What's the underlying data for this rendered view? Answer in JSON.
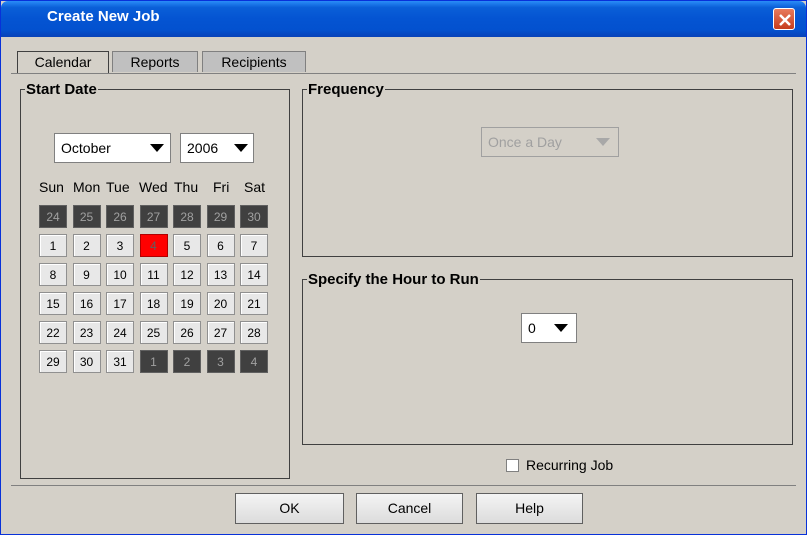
{
  "window": {
    "title": "Create New Job"
  },
  "tabs": [
    {
      "label": "Calendar"
    },
    {
      "label": "Reports"
    },
    {
      "label": "Recipients"
    }
  ],
  "start_date": {
    "legend": "Start Date",
    "month": "October",
    "year": "2006",
    "weekdays": [
      "Sun",
      "Mon",
      "Tue",
      "Wed",
      "Thu",
      "Fri",
      "Sat"
    ],
    "weeks": [
      [
        "24",
        "25",
        "26",
        "27",
        "28",
        "29",
        "30"
      ],
      [
        "1",
        "2",
        "3",
        "4",
        "5",
        "6",
        "7"
      ],
      [
        "8",
        "9",
        "10",
        "11",
        "12",
        "13",
        "14"
      ],
      [
        "15",
        "16",
        "17",
        "18",
        "19",
        "20",
        "21"
      ],
      [
        "22",
        "23",
        "24",
        "25",
        "26",
        "27",
        "28"
      ],
      [
        "29",
        "30",
        "31",
        "1",
        "2",
        "3",
        "4"
      ]
    ],
    "selected_day": "4"
  },
  "frequency": {
    "legend": "Frequency",
    "value": "Once a Day"
  },
  "hour": {
    "legend": "Specify the Hour to Run",
    "value": "0"
  },
  "recurring": {
    "label": "Recurring Job",
    "checked": false
  },
  "buttons": {
    "ok": "OK",
    "cancel": "Cancel",
    "help": "Help"
  },
  "colors": {
    "title_bar": "#0454d2",
    "selected_day": "#ff0000",
    "other_month_day": "#404040",
    "dialog_bg": "#d4d0c8"
  }
}
